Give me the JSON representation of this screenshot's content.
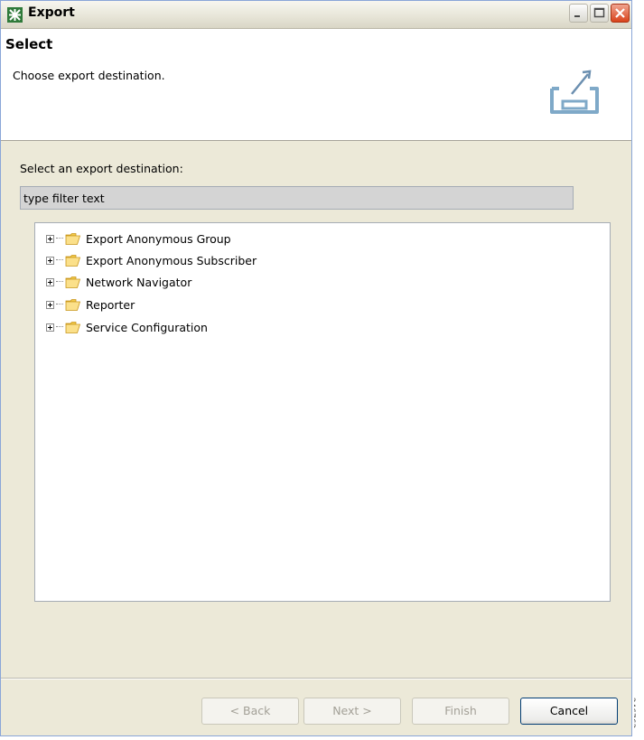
{
  "window": {
    "title": "Export"
  },
  "banner": {
    "title": "Select",
    "description": "Choose export destination."
  },
  "filter": {
    "label": "Select an export destination:",
    "value": "type filter text"
  },
  "tree": {
    "items": [
      {
        "label": "Export Anonymous Group"
      },
      {
        "label": "Export Anonymous Subscriber"
      },
      {
        "label": "Network Navigator"
      },
      {
        "label": "Reporter"
      },
      {
        "label": "Service Configuration"
      }
    ]
  },
  "buttons": {
    "back": "< Back",
    "next": "Next >",
    "finish": "Finish",
    "cancel": "Cancel"
  },
  "side_note": "246763"
}
